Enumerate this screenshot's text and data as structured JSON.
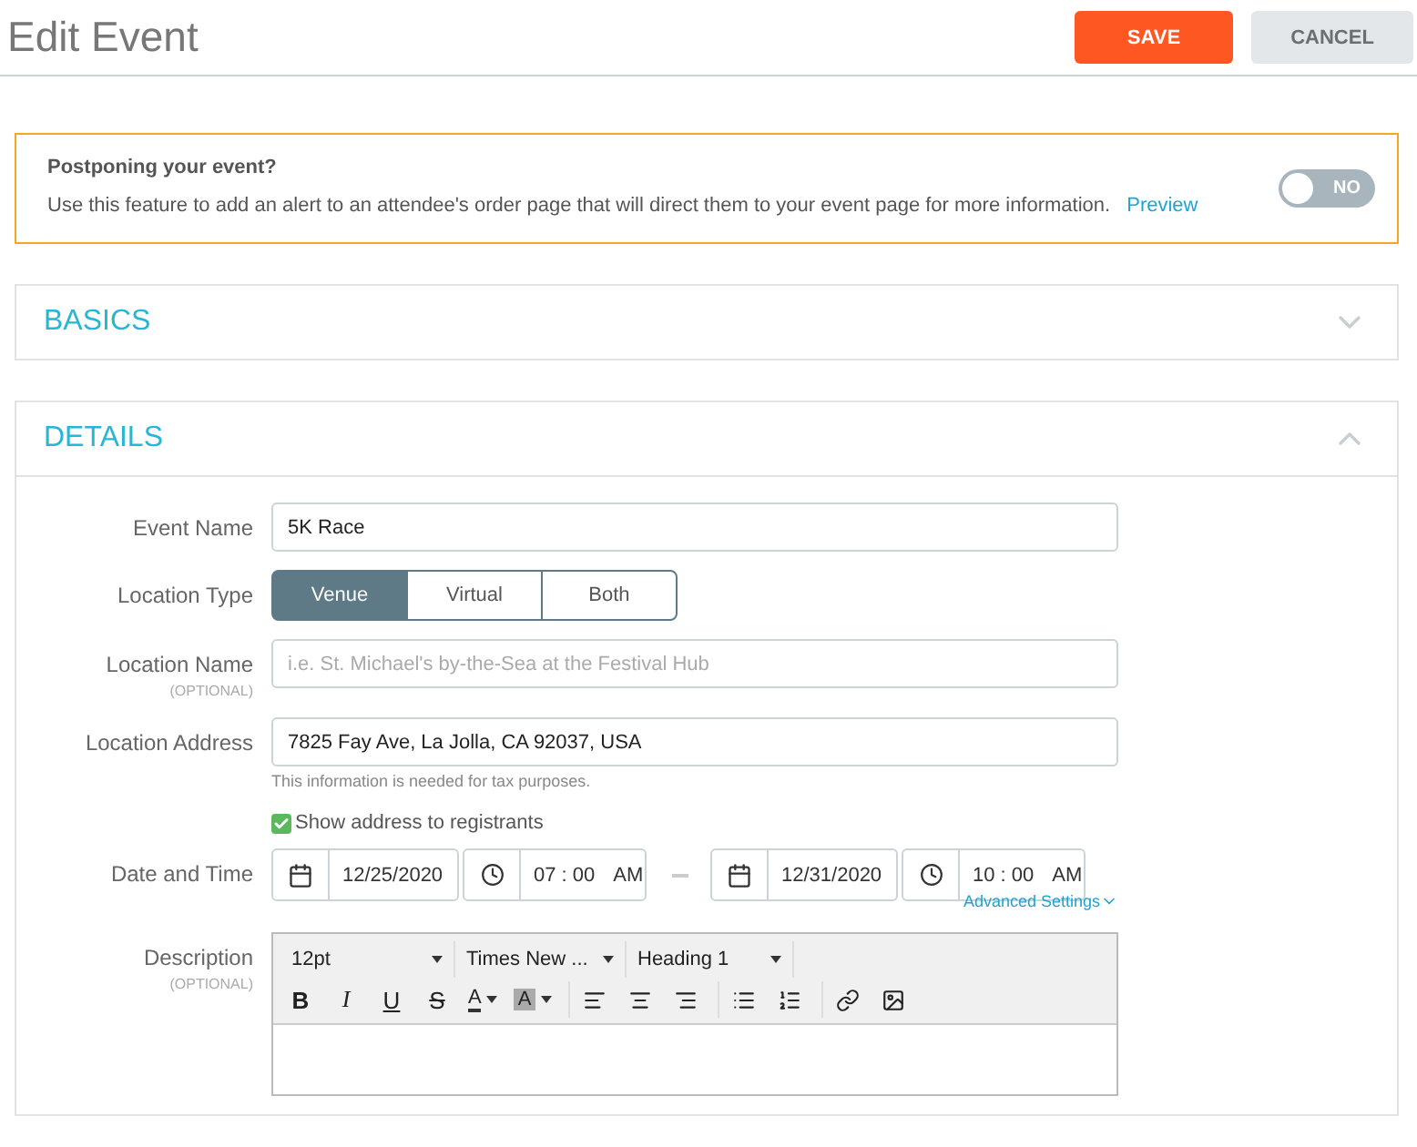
{
  "header": {
    "title": "Edit Event",
    "buttons": [
      {
        "label": "SAVE",
        "kind": "primary"
      },
      {
        "label": "CANCEL",
        "kind": "secondary"
      }
    ]
  },
  "alert": {
    "title": "Postponing your event?",
    "text": "Use this feature to add an alert to an attendee's order page that will direct them to your event page for more information.",
    "link": "Preview",
    "toggle": {
      "on": false,
      "label": "NO"
    }
  },
  "panels": [
    {
      "title": "BASICS",
      "expanded": false
    },
    {
      "title": "DETAILS",
      "expanded": true
    }
  ],
  "form": {
    "event_name": {
      "label": "Event Name",
      "value": "5K Race"
    },
    "location_type": {
      "label": "Location Type",
      "options": [
        {
          "label": "Venue",
          "selected": true
        },
        {
          "label": "Virtual",
          "selected": false
        },
        {
          "label": "Both",
          "selected": false
        }
      ]
    },
    "location_name": {
      "label": "Location Name",
      "note": "(OPTIONAL)",
      "placeholder": "i.e. St. Michael's by-the-Sea at the Festival Hub"
    },
    "location_address": {
      "label": "Location Address",
      "value": "7825 Fay Ave, La Jolla, CA 92037, USA",
      "hint": "This information is needed for tax purposes.",
      "show_address": {
        "label": "Show address to registrants",
        "checked": true
      }
    },
    "date_time": {
      "label": "Date and Time",
      "start": {
        "date": "12/25/2020",
        "time": "07 : 00",
        "period": "AM"
      },
      "end": {
        "date": "12/31/2020",
        "time": "10 : 00",
        "period": "AM"
      },
      "advanced": "Advanced Settings"
    },
    "description": {
      "label": "Description",
      "note": "(OPTIONAL)",
      "dropdowns": [
        "12pt",
        "Times New ...",
        "Heading 1"
      ],
      "buttons": [
        {
          "kind": "bold",
          "label": "B"
        },
        {
          "kind": "italic",
          "label": "I"
        },
        {
          "kind": "underline",
          "label": "U"
        },
        {
          "kind": "strike",
          "label": "S"
        },
        {
          "kind": "color",
          "label": "A"
        },
        {
          "kind": "highlight",
          "label": "A"
        },
        {
          "kind": "align-left"
        },
        {
          "kind": "align-center"
        },
        {
          "kind": "align-right"
        },
        {
          "kind": "bullets"
        },
        {
          "kind": "numbers"
        },
        {
          "kind": "link"
        },
        {
          "kind": "image"
        }
      ]
    }
  }
}
